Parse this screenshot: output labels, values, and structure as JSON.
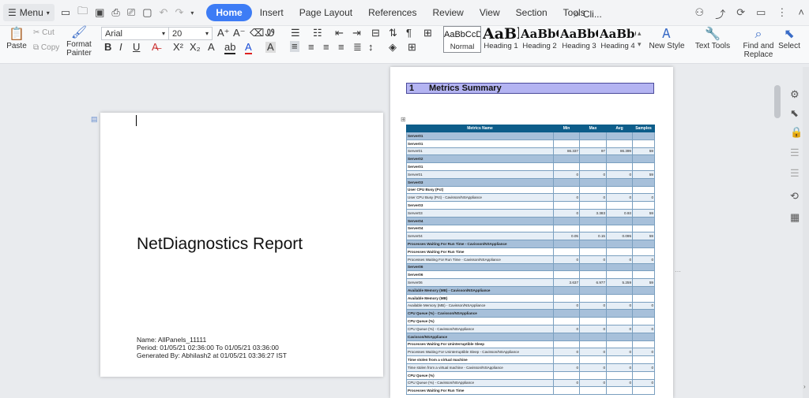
{
  "topbar": {
    "menu_label": "Menu",
    "tabs": [
      "Home",
      "Insert",
      "Page Layout",
      "References",
      "Review",
      "View",
      "Section",
      "Tools"
    ],
    "search_text": "Cli..."
  },
  "ribbon": {
    "paste": "Paste",
    "cut": "Cut",
    "copy": "Copy",
    "format_painter": "Format Painter",
    "font_name": "Arial",
    "font_size": "20",
    "styles": [
      {
        "sample": "AaBbCcDd",
        "name": "Normal"
      },
      {
        "sample": "AaBl",
        "name": "Heading 1"
      },
      {
        "sample": "AaBbC",
        "name": "Heading 2"
      },
      {
        "sample": "AaBbC",
        "name": "Heading 3"
      },
      {
        "sample": "AaBbC",
        "name": "Heading 4"
      }
    ],
    "new_style": "New Style",
    "text_tools": "Text Tools",
    "find_replace": "Find and Replace",
    "select": "Select"
  },
  "page1": {
    "title": "NetDiagnostics Report",
    "meta_name": "Name: AllPanels_11111",
    "meta_period": "Period: 01/05/21 02:36:00 To 01/05/21 03:36:00",
    "meta_generated": "Generated By: Abhilash2 at 01/05/21 03:36:27 IST"
  },
  "page2": {
    "heading_num": "1",
    "heading_text": "Metrics Summary",
    "columns": [
      "Metrics Name",
      "Min",
      "Max",
      "Avg",
      "Samples"
    ],
    "rows": [
      {
        "t": "grp",
        "c": [
          "Server01",
          "",
          "",
          "",
          ""
        ]
      },
      {
        "t": "sub",
        "c": [
          "Server01",
          "",
          "",
          "",
          ""
        ]
      },
      {
        "t": "data",
        "c": [
          "Server01",
          "86.337",
          "97",
          "86.399",
          "59"
        ]
      },
      {
        "t": "grp",
        "c": [
          "Server02",
          "",
          "",
          "",
          ""
        ]
      },
      {
        "t": "sub",
        "c": [
          "Server01",
          "",
          "",
          "",
          ""
        ]
      },
      {
        "t": "data",
        "c": [
          "Server01",
          "0",
          "0",
          "0",
          "59"
        ]
      },
      {
        "t": "grp",
        "c": [
          "Server03",
          "",
          "",
          "",
          ""
        ]
      },
      {
        "t": "sub",
        "c": [
          "User CPU Busy (Pct)",
          "",
          "",
          "",
          ""
        ]
      },
      {
        "t": "data",
        "c": [
          "User CPU Busy (Pct) - Cavisson/NSAppliance",
          "0",
          "0",
          "0",
          "0"
        ]
      },
      {
        "t": "sub",
        "c": [
          "Server03",
          "",
          "",
          "",
          ""
        ]
      },
      {
        "t": "data",
        "c": [
          "Server03",
          "0",
          "3.383",
          "0.93",
          "59"
        ]
      },
      {
        "t": "grp",
        "c": [
          "Server04",
          "",
          "",
          "",
          ""
        ]
      },
      {
        "t": "sub",
        "c": [
          "Server04",
          "",
          "",
          "",
          ""
        ]
      },
      {
        "t": "data",
        "c": [
          "Server04",
          "0.05",
          "0.15",
          "0.095",
          "59"
        ]
      },
      {
        "t": "grp",
        "c": [
          "Processes Waiting For Run Time - Cavisson/NSAppliance",
          "",
          "",
          "",
          ""
        ]
      },
      {
        "t": "sub",
        "c": [
          "Processes Waiting For Run Time",
          "",
          "",
          "",
          ""
        ]
      },
      {
        "t": "data",
        "c": [
          "Processes Waiting For Run Time - Cavisson/NSAppliance",
          "0",
          "0",
          "0",
          "0"
        ]
      },
      {
        "t": "grp",
        "c": [
          "Server06",
          "",
          "",
          "",
          ""
        ]
      },
      {
        "t": "sub",
        "c": [
          "Server06",
          "",
          "",
          "",
          ""
        ]
      },
      {
        "t": "data",
        "c": [
          "Server06",
          "3.637",
          "6.977",
          "5.259",
          "59"
        ]
      },
      {
        "t": "grp",
        "c": [
          "Available Memory (MB) - Cavisson/NSAppliance",
          "",
          "",
          "",
          ""
        ]
      },
      {
        "t": "sub",
        "c": [
          "Available Memory (MB)",
          "",
          "",
          "",
          ""
        ]
      },
      {
        "t": "data",
        "c": [
          "Available Memory (MB) - Cavisson/NSAppliance",
          "0",
          "0",
          "0",
          "0"
        ]
      },
      {
        "t": "grp",
        "c": [
          "CPU Queue (%) - Cavisson/NSAppliance",
          "",
          "",
          "",
          ""
        ]
      },
      {
        "t": "sub",
        "c": [
          "CPU Queue (%)",
          "",
          "",
          "",
          ""
        ]
      },
      {
        "t": "data",
        "c": [
          "CPU Queue (%) - Cavisson/NSAppliance",
          "0",
          "0",
          "0",
          "0"
        ]
      },
      {
        "t": "grp",
        "c": [
          "Cavisson/NSAppliance",
          "",
          "",
          "",
          ""
        ]
      },
      {
        "t": "sub",
        "c": [
          "Processes Waiting For Uninterruptible Sleep",
          "",
          "",
          "",
          ""
        ]
      },
      {
        "t": "data",
        "c": [
          "Processes Waiting For Uninterruptible Sleep - Cavisson/NSAppliance",
          "0",
          "0",
          "0",
          "0"
        ]
      },
      {
        "t": "sub",
        "c": [
          "Time stolen from a virtual machine",
          "",
          "",
          "",
          ""
        ]
      },
      {
        "t": "data",
        "c": [
          "Time stolen from a virtual machine - Cavisson/NSAppliance",
          "0",
          "0",
          "0",
          "0"
        ]
      },
      {
        "t": "sub",
        "c": [
          "CPU Queue (%)",
          "",
          "",
          "",
          ""
        ]
      },
      {
        "t": "data",
        "c": [
          "CPU Queue (%) - Cavisson/NSAppliance",
          "0",
          "0",
          "0",
          "0"
        ]
      },
      {
        "t": "sub",
        "c": [
          "Processes Waiting For Run Time",
          "",
          "",
          "",
          ""
        ]
      }
    ]
  }
}
